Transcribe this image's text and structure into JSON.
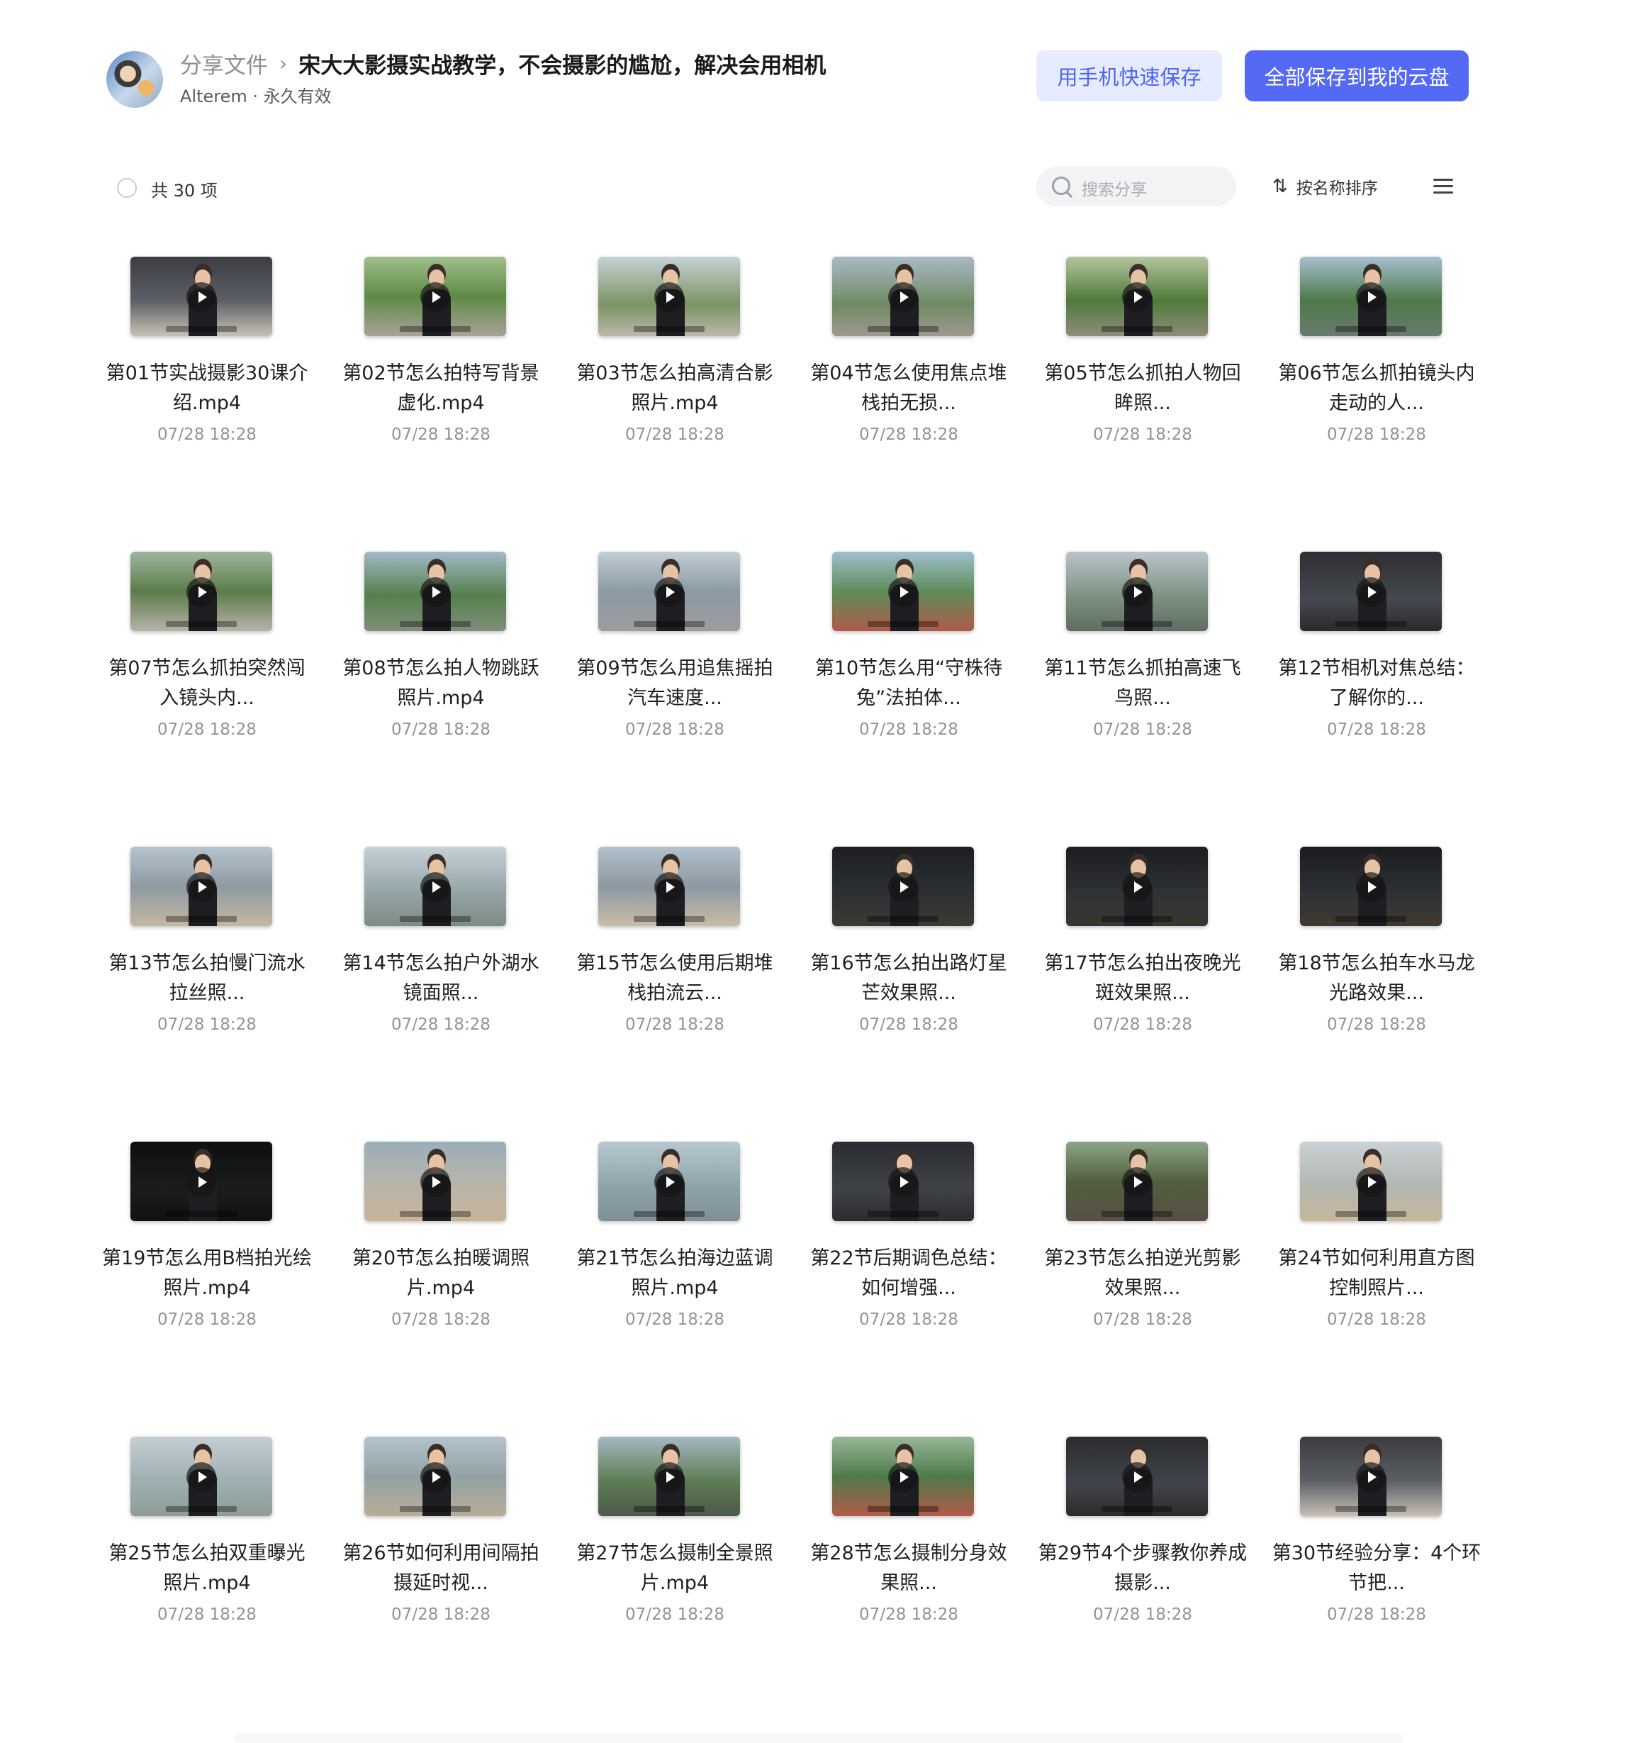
{
  "header": {
    "breadcrumb_root": "分享文件",
    "breadcrumb_sep": "›",
    "title": "宋大大影摄实战教学，不会摄影的尴尬，解决会用相机",
    "owner": "Alterem · 永久有效",
    "btn_phone": "用手机快速保存",
    "btn_save": "全部保存到我的云盘"
  },
  "toolbar": {
    "count": "共 30 项",
    "search_placeholder": "搜索分享",
    "sort_icon": "⇅",
    "sort_label": "按名称排序"
  },
  "colors": {
    "accent": "#5469f4",
    "accent_soft": "#e6ebff"
  },
  "items": [
    {
      "name": "第01节实战摄影30课介绍.mp4",
      "time": "07/28 18:28",
      "bg": "linear-gradient(180deg,#3b3d42 0%,#5c5f66 55%,#c9c1b5 100%)"
    },
    {
      "name": "第02节怎么拍特写背景虚化.mp4",
      "time": "07/28 18:28",
      "bg": "linear-gradient(180deg,#9fbf8a 0%,#5e8a45 50%,#a7a398 100%)"
    },
    {
      "name": "第03节怎么拍高清合影照片.mp4",
      "time": "07/28 18:28",
      "bg": "linear-gradient(180deg,#c7d2d8 0%,#7a9462 60%,#bdb6ac 100%)"
    },
    {
      "name": "第04节怎么使用焦点堆栈拍无损...",
      "time": "07/28 18:28",
      "bg": "linear-gradient(180deg,#aab9c6 0%,#6f8a62 60%,#9d9a90 100%)"
    },
    {
      "name": "第05节怎么抓拍人物回眸照...",
      "time": "07/28 18:28",
      "bg": "linear-gradient(180deg,#b5c59e 0%,#4f7a3a 55%,#8f8c7a 100%)"
    },
    {
      "name": "第06节怎么抓拍镜头内走动的人...",
      "time": "07/28 18:28",
      "bg": "linear-gradient(180deg,#a7c0d0 0%,#4d7a48 55%,#6a7a70 100%)"
    },
    {
      "name": "第07节怎么抓拍突然闯入镜头内...",
      "time": "07/28 18:28",
      "bg": "linear-gradient(180deg,#9fb5a0 0%,#5c7c4a 50%,#b6b3a8 100%)"
    },
    {
      "name": "第08节怎么拍人物跳跃照片.mp4",
      "time": "07/28 18:28",
      "bg": "linear-gradient(180deg,#a4b9c7 0%,#557f4c 55%,#7f8f7c 100%)"
    },
    {
      "name": "第09节怎么用追焦摇拍汽车速度...",
      "time": "07/28 18:28",
      "bg": "linear-gradient(180deg,#c3ced6 0%,#8a9aa4 50%,#9c9c9e 100%)"
    },
    {
      "name": "第10节怎么用“守株待兔”法拍体...",
      "time": "07/28 18:28",
      "bg": "linear-gradient(180deg,#9fc0cf 0%,#5e8c58 50%,#b05a4a 100%)"
    },
    {
      "name": "第11节怎么抓拍高速飞鸟照...",
      "time": "07/28 18:28",
      "bg": "linear-gradient(180deg,#b9c5cc 0%,#7f9382 55%,#5e6e62 100%)"
    },
    {
      "name": "第12节相机对焦总结：了解你的...",
      "time": "07/28 18:28",
      "bg": "linear-gradient(180deg,#2d2f34 0%,#45484e 60%,#2a2a2c 100%)"
    },
    {
      "name": "第13节怎么拍慢门流水拉丝照...",
      "time": "07/28 18:28",
      "bg": "linear-gradient(180deg,#b6c4cf 0%,#8e9aa2 50%,#c4b7a1 100%)"
    },
    {
      "name": "第14节怎么拍户外湖水镜面照...",
      "time": "07/28 18:28",
      "bg": "linear-gradient(180deg,#c6d1d8 0%,#97a6a8 55%,#7d8c86 100%)"
    },
    {
      "name": "第15节怎么使用后期堆栈拍流云...",
      "time": "07/28 18:28",
      "bg": "linear-gradient(180deg,#b3c1cc 0%,#8c98a2 50%,#c9bca6 100%)"
    },
    {
      "name": "第16节怎么拍出路灯星芒效果照...",
      "time": "07/28 18:28",
      "bg": "linear-gradient(180deg,#1c1e22 0%,#2c3033 60%,#3c3a34 100%)"
    },
    {
      "name": "第17节怎么拍出夜晚光斑效果照...",
      "time": "07/28 18:28",
      "bg": "linear-gradient(180deg,#1b1d20 0%,#2f3236 60%,#3a3630 100%)"
    },
    {
      "name": "第18节怎么拍车水马龙光路效果...",
      "time": "07/28 18:28",
      "bg": "linear-gradient(180deg,#1a1c20 0%,#2e3136 60%,#403a30 100%)"
    },
    {
      "name": "第19节怎么用B档拍光绘照片.mp4",
      "time": "07/28 18:28",
      "bg": "linear-gradient(180deg,#0e0f10 0%,#1b1c1e 60%,#101112 100%)"
    },
    {
      "name": "第20节怎么拍暖调照片.mp4",
      "time": "07/28 18:28",
      "bg": "linear-gradient(180deg,#9aaebb 0%,#b6b4aa 50%,#c9b49a 100%)"
    },
    {
      "name": "第21节怎么拍海边蓝调照片.mp4",
      "time": "07/28 18:28",
      "bg": "linear-gradient(180deg,#b8c7cf 0%,#8fa4ab 55%,#7e9096 100%)"
    },
    {
      "name": "第22节后期调色总结：如何增强...",
      "time": "07/28 18:28",
      "bg": "linear-gradient(180deg,#2a2c31 0%,#3f4248 60%,#2b2b2d 100%)"
    },
    {
      "name": "第23节怎么拍逆光剪影效果照...",
      "time": "07/28 18:28",
      "bg": "linear-gradient(180deg,#8da58a 0%,#51603f 50%,#5a4d44 100%)"
    },
    {
      "name": "第24节如何利用直方图控制照片...",
      "time": "07/28 18:28",
      "bg": "linear-gradient(180deg,#c9d2d6 0%,#b3b7b1 55%,#c7b79c 100%)"
    },
    {
      "name": "第25节怎么拍双重曝光照片.mp4",
      "time": "07/28 18:28",
      "bg": "linear-gradient(180deg,#c5cfd4 0%,#9fb0b2 55%,#8e9d98 100%)"
    },
    {
      "name": "第26节如何利用间隔拍摄延时视...",
      "time": "07/28 18:28",
      "bg": "linear-gradient(180deg,#b4c3cc 0%,#92a2a6 50%,#b9ad98 100%)"
    },
    {
      "name": "第27节怎么摄制全景照片.mp4",
      "time": "07/28 18:28",
      "bg": "linear-gradient(180deg,#a5b8c3 0%,#5f7d55 55%,#4c5a4a 100%)"
    },
    {
      "name": "第28节怎么摄制分身效果照...",
      "time": "07/28 18:28",
      "bg": "linear-gradient(180deg,#9ab79a 0%,#4e7a4a 50%,#b35a48 100%)"
    },
    {
      "name": "第29节4个步骤教你养成摄影...",
      "time": "07/28 18:28",
      "bg": "linear-gradient(180deg,#2a2c30 0%,#41444a 60%,#2c2c2e 100%)"
    },
    {
      "name": "第30节经验分享：4个环节把...",
      "time": "07/28 18:28",
      "bg": "linear-gradient(180deg,#3a3c41 0%,#5b5e64 55%,#c7bfb2 100%)"
    }
  ]
}
